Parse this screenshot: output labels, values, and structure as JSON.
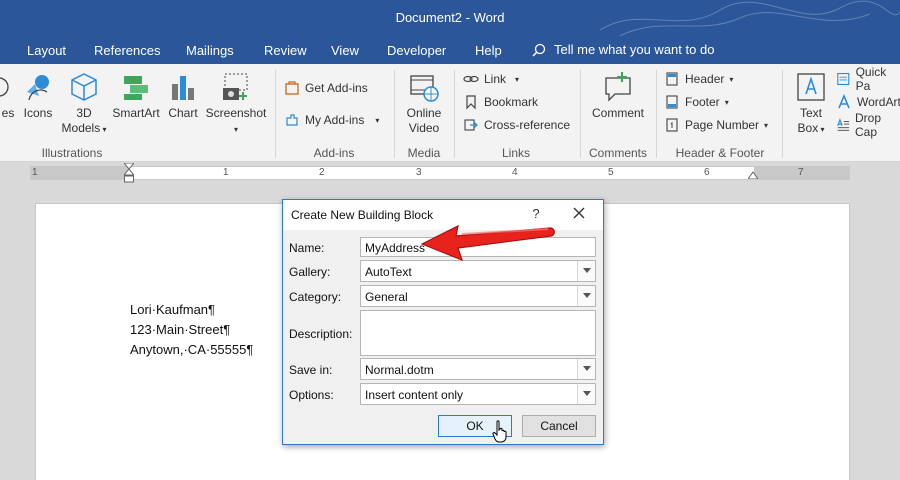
{
  "window": {
    "title": "Document2 - Word"
  },
  "tabs": {
    "layout": "Layout",
    "references": "References",
    "mailings": "Mailings",
    "review": "Review",
    "view": "View",
    "developer": "Developer",
    "help": "Help",
    "tell_me": "Tell me what you want to do"
  },
  "ribbon": {
    "illustrations": {
      "shapes": "es",
      "icons": "Icons",
      "models_line1": "3D",
      "models_line2": "Models",
      "smartart": "SmartArt",
      "chart": "Chart",
      "screenshot": "Screenshot",
      "label": "Illustrations"
    },
    "addins": {
      "get": "Get Add-ins",
      "my": "My Add-ins",
      "label": "Add-ins"
    },
    "media": {
      "online_line1": "Online",
      "online_line2": "Video",
      "label": "Media"
    },
    "links": {
      "link": "Link",
      "bookmark": "Bookmark",
      "crossref": "Cross-reference",
      "label": "Links"
    },
    "comments": {
      "comment": "Comment",
      "label": "Comments"
    },
    "header_footer": {
      "header": "Header",
      "footer": "Footer",
      "page_number": "Page Number",
      "label": "Header & Footer"
    },
    "text": {
      "textbox_line1": "Text",
      "textbox_line2": "Box",
      "quickparts": "Quick Pa",
      "wordart": "WordArt",
      "dropcap": "Drop Cap"
    }
  },
  "ruler": {
    "numbers": [
      "1",
      "1",
      "2",
      "3",
      "4",
      "5",
      "6",
      "7"
    ]
  },
  "document": {
    "lines": [
      "Lori·Kaufman¶",
      "123·Main·Street¶",
      "Anytown,·CA·55555¶"
    ]
  },
  "dialog": {
    "title": "Create New Building Block",
    "help": "?",
    "name_label": "Name:",
    "name_value": "MyAddress",
    "gallery_label": "Gallery:",
    "gallery_value": "AutoText",
    "category_label": "Category:",
    "category_value": "General",
    "description_label": "Description:",
    "description_value": "",
    "savein_label": "Save in:",
    "savein_value": "Normal.dotm",
    "options_label": "Options:",
    "options_value": "Insert content only",
    "ok": "OK",
    "cancel": "Cancel"
  },
  "colors": {
    "accent": "#2b579a",
    "dialog_border": "#2b78d6",
    "arrow": "#e8231e"
  }
}
